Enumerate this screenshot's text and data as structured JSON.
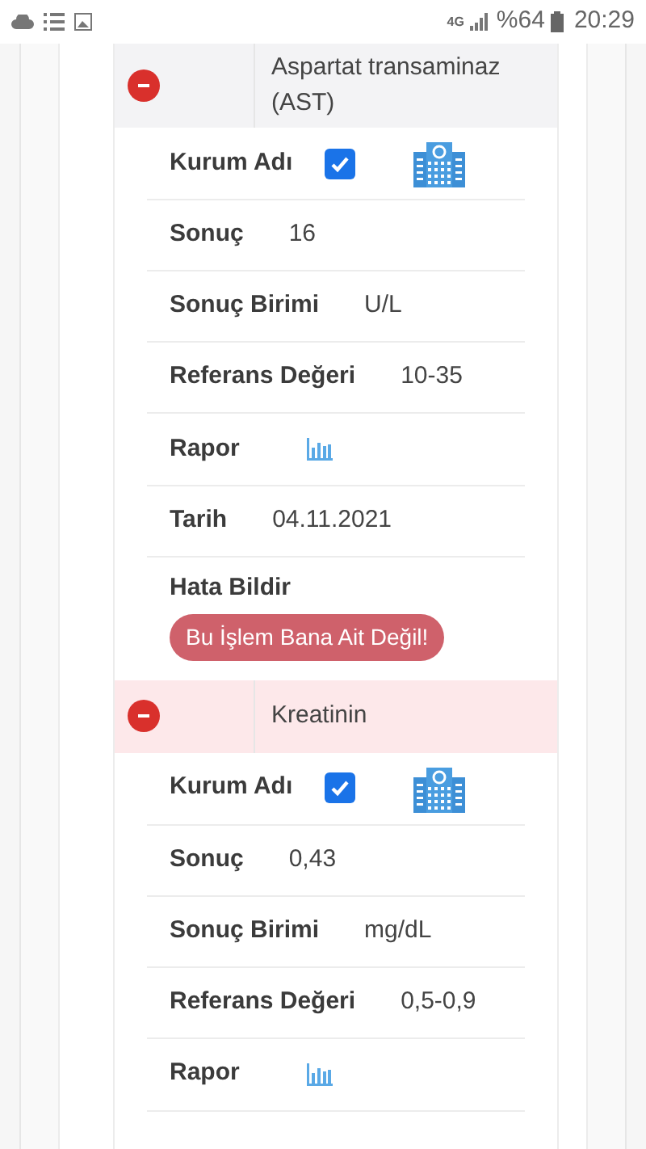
{
  "status_bar": {
    "network": "4G",
    "battery": "%64",
    "time": "20:29"
  },
  "tests": [
    {
      "title": "Aspartat transaminaz (AST)",
      "color": "#f3f3f5",
      "rows": [
        {
          "kind": "checkbox",
          "label": "Kurum Adı",
          "checked": true
        },
        {
          "kind": "text",
          "label": "Sonuç",
          "value": "16"
        },
        {
          "kind": "text",
          "label": "Sonuç Birimi",
          "value": "U/L"
        },
        {
          "kind": "text",
          "label": "Referans Değeri",
          "value": "10-35"
        },
        {
          "kind": "chart",
          "label": "Rapor"
        },
        {
          "kind": "text",
          "label": "Tarih",
          "value": "04.11.2021"
        },
        {
          "kind": "action",
          "label": "Hata Bildir",
          "button": "Bu İşlem Bana Ait Değil!"
        }
      ]
    },
    {
      "title": "Kreatinin",
      "color": "#fde8ea",
      "rows": [
        {
          "kind": "checkbox",
          "label": "Kurum Adı",
          "checked": true
        },
        {
          "kind": "text",
          "label": "Sonuç",
          "value": "0,43"
        },
        {
          "kind": "text",
          "label": "Sonuç Birimi",
          "value": "mg/dL"
        },
        {
          "kind": "text",
          "label": "Referans Değeri",
          "value": "0,5-0,9"
        },
        {
          "kind": "chart",
          "label": "Rapor"
        }
      ]
    }
  ]
}
